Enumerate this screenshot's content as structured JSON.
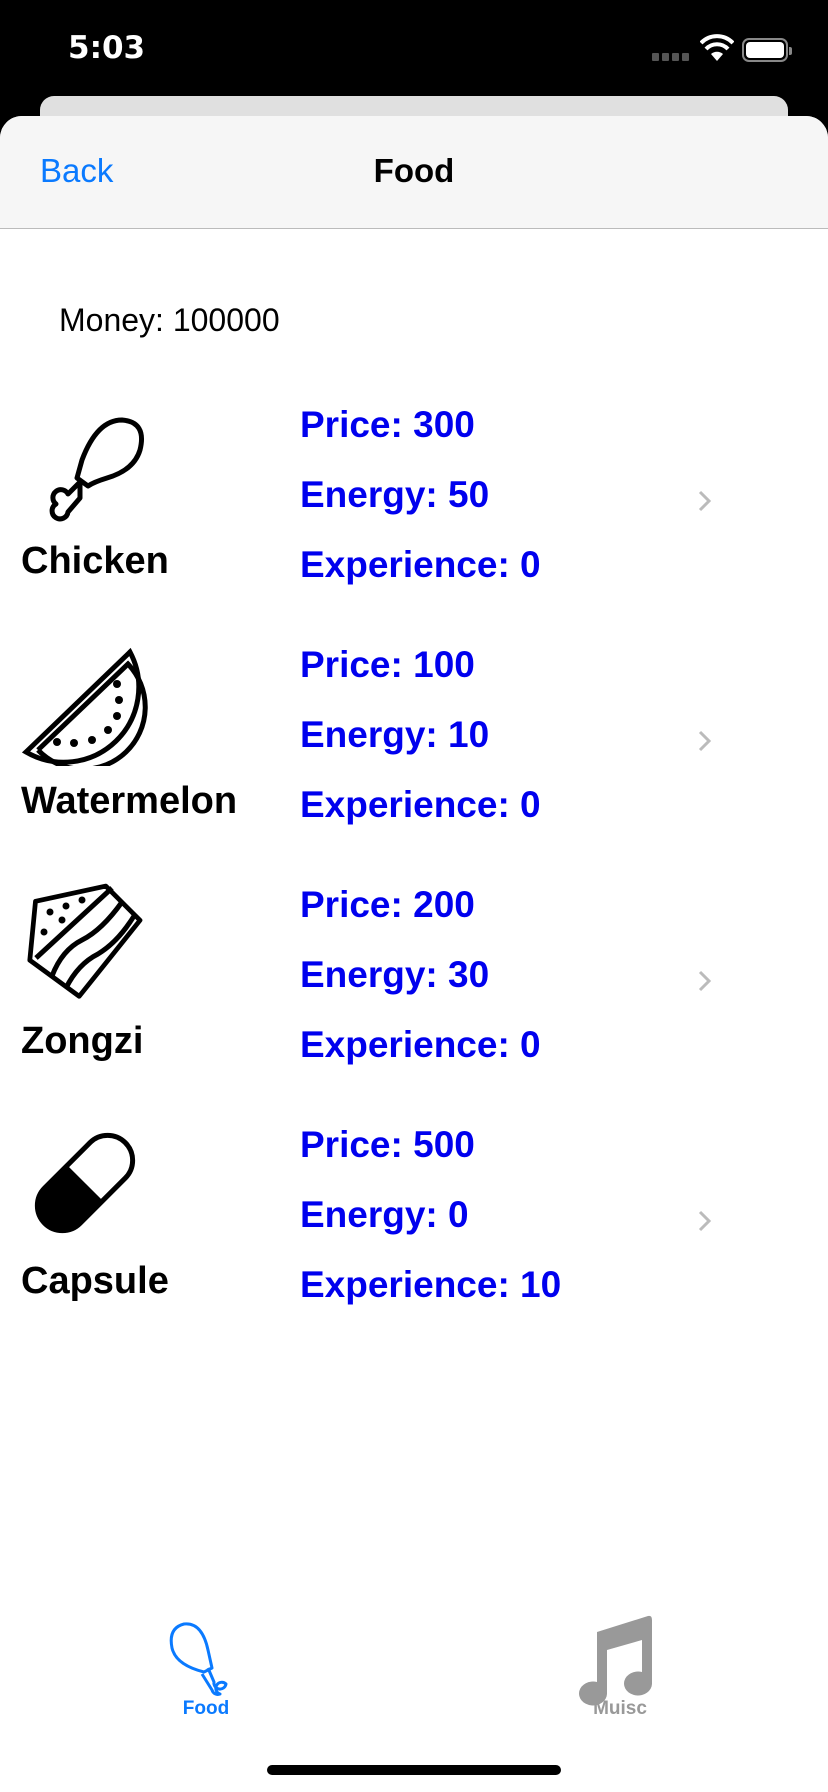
{
  "status_bar": {
    "time": "5:03"
  },
  "nav": {
    "back_label": "Back",
    "title": "Food"
  },
  "money_label": "Money: 100000",
  "items": [
    {
      "name": "Chicken",
      "icon": "chicken-leg-icon",
      "price": "Price: 300",
      "energy": "Energy: 50",
      "experience": "Experience: 0"
    },
    {
      "name": "Watermelon",
      "icon": "watermelon-icon",
      "price": "Price: 100",
      "energy": "Energy: 10",
      "experience": "Experience: 0"
    },
    {
      "name": "Zongzi",
      "icon": "zongzi-icon",
      "price": "Price: 200",
      "energy": "Energy: 30",
      "experience": "Experience: 0"
    },
    {
      "name": "Capsule",
      "icon": "capsule-icon",
      "price": "Price: 500",
      "energy": "Energy: 0",
      "experience": "Experience: 10"
    }
  ],
  "tabs": [
    {
      "label": "Food",
      "active": true
    },
    {
      "label": "Muisc",
      "active": false
    }
  ],
  "colors": {
    "accent": "#0a7aff",
    "stat": "#0000ee",
    "inactive": "#999999"
  }
}
